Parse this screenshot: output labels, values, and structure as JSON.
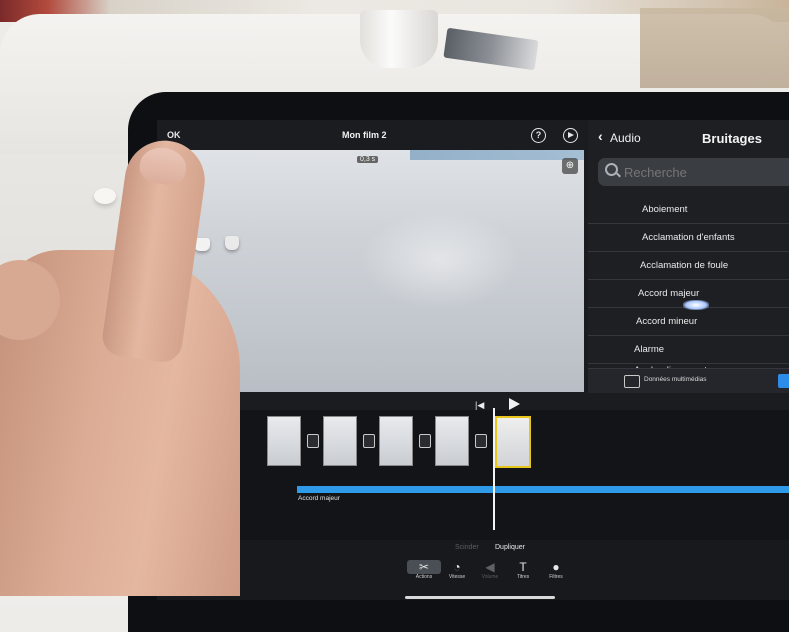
{
  "app": {
    "title": "Mon film 2",
    "ok_label": "OK",
    "help_glyph": "?",
    "duration_badge": "0,3 s",
    "zoom_glyph": "⊕"
  },
  "audio_panel": {
    "back_label": "Audio",
    "title": "Bruitages",
    "search_placeholder": "Recherche",
    "items": [
      {
        "label": "Aboiement"
      },
      {
        "label": "Acclamation d'enfants"
      },
      {
        "label": "Acclamation de foule"
      },
      {
        "label": "Accord majeur"
      },
      {
        "label": "Accord mineur"
      },
      {
        "label": "Alarme"
      },
      {
        "label": "Applaudissements"
      }
    ],
    "footer_label": "Données multimédias",
    "accent": "#2c8ce8"
  },
  "timeline": {
    "audio_clip_label": "Accord majeur",
    "selected_clip_color": "#e7c51b",
    "audio_track_color": "#2f9ae8"
  },
  "actions": {
    "scinder": "Scinder",
    "dupliquer": "Dupliquer",
    "tools": [
      {
        "icon": "scissors-icon",
        "glyph": "✂",
        "label": "Actions"
      },
      {
        "icon": "speed-icon",
        "glyph": "◔",
        "label": "Vitesse"
      },
      {
        "icon": "volume-icon",
        "glyph": "◀",
        "label": "Volume"
      },
      {
        "icon": "titles-icon",
        "glyph": "T",
        "label": "Titres"
      },
      {
        "icon": "filters-icon",
        "glyph": "●",
        "label": "Filtres"
      }
    ]
  }
}
